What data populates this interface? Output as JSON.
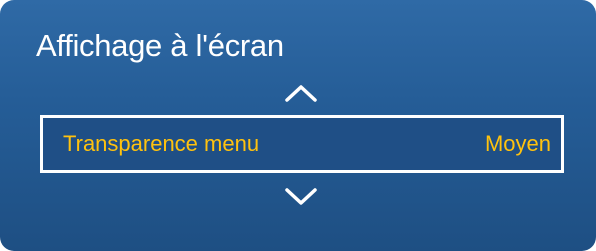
{
  "menu": {
    "title": "Affichage à l'écran",
    "item": {
      "label": "Transparence menu",
      "value": "Moyen"
    },
    "icons": {
      "up": "chevron-up-icon",
      "down": "chevron-down-icon"
    },
    "colors": {
      "panel_background": "#2a609c",
      "highlight_text": "#ffc20e",
      "title_text": "#ffffff",
      "focus_border": "#ffffff"
    }
  }
}
